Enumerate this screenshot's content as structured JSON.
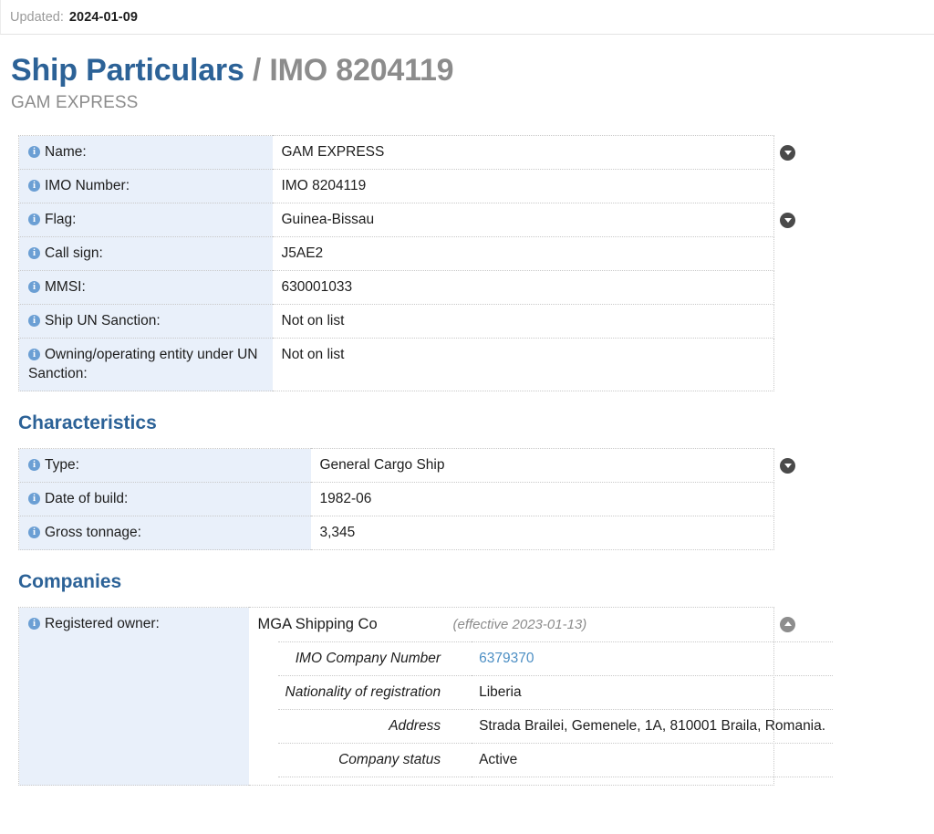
{
  "updated": {
    "label": "Updated:",
    "date": "2024-01-09"
  },
  "header": {
    "title_main": "Ship Particulars",
    "title_separator": "/",
    "title_imo": "IMO 8204119",
    "subtitle": "GAM EXPRESS"
  },
  "particulars": {
    "rows": [
      {
        "label": "Name:",
        "value": "GAM EXPRESS",
        "toggle": "down"
      },
      {
        "label": "IMO Number:",
        "value": "IMO 8204119",
        "toggle": ""
      },
      {
        "label": "Flag:",
        "value": "Guinea-Bissau",
        "toggle": "down"
      },
      {
        "label": "Call sign:",
        "value": "J5AE2",
        "toggle": ""
      },
      {
        "label": "MMSI:",
        "value": "630001033",
        "toggle": ""
      },
      {
        "label": "Ship UN Sanction:",
        "value": "Not on list",
        "toggle": ""
      },
      {
        "label": "Owning/operating entity under UN Sanction:",
        "value": "Not on list",
        "toggle": ""
      }
    ]
  },
  "characteristics": {
    "heading": "Characteristics",
    "rows": [
      {
        "label": "Type:",
        "value": "General Cargo Ship",
        "toggle": "down"
      },
      {
        "label": "Date of build:",
        "value": "1982-06",
        "toggle": ""
      },
      {
        "label": "Gross tonnage:",
        "value": "3,345",
        "toggle": ""
      }
    ]
  },
  "companies": {
    "heading": "Companies",
    "row_label": "Registered owner:",
    "toggle": "up",
    "company": {
      "name": "MGA Shipping Co",
      "effective": "(effective 2023-01-13)",
      "details": [
        {
          "key": "IMO Company Number",
          "value": "6379370",
          "is_link": true
        },
        {
          "key": "Nationality of registration",
          "value": "Liberia",
          "is_link": false
        },
        {
          "key": "Address",
          "value": "Strada Brailei, Gemenele, 1A, 810001 Braila, Romania.",
          "is_link": false
        },
        {
          "key": "Company status",
          "value": "Active",
          "is_link": false
        }
      ]
    }
  },
  "colors": {
    "title_blue": "#2c6297",
    "label_bg": "#e9f0fa",
    "info_icon": "#6b9fd4",
    "link_blue": "#4d8fc4",
    "muted_gray": "#8c8c8c"
  }
}
